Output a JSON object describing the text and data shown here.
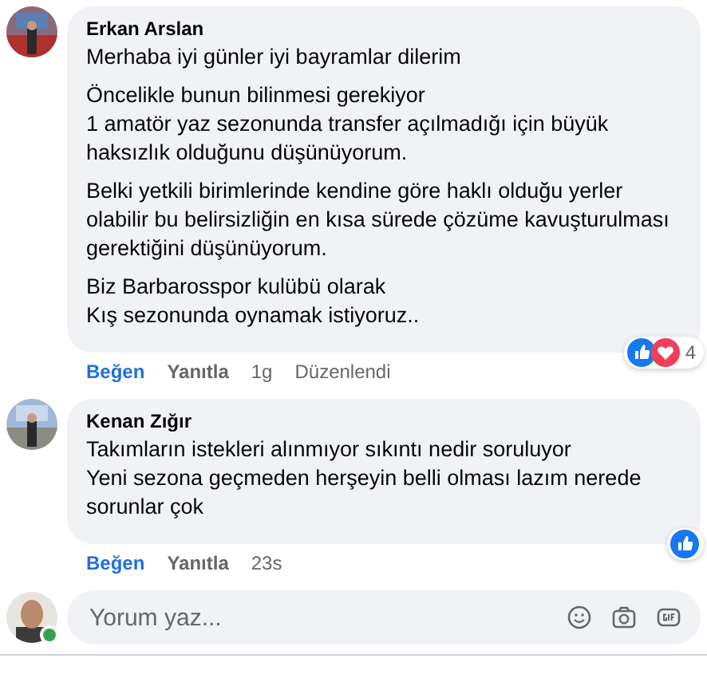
{
  "comments": [
    {
      "author": "Erkan Arslan",
      "paragraphs": [
        [
          "Merhaba iyi günler iyi bayramlar dilerim"
        ],
        [
          "Öncelikle bunun bilinmesi gerekiyor",
          "1 amatör yaz sezonunda transfer açılmadığı için büyük haksızlık olduğunu düşünüyorum."
        ],
        [
          "Belki yetkili birimlerinde kendine göre haklı olduğu yerler olabilir bu belirsizliğin en kısa sürede çözüme kavuşturulması gerektiğini düşünüyorum."
        ],
        [
          "Biz Barbarosspor kulübü olarak",
          "Kış sezonunda oynamak istiyoruz.."
        ]
      ],
      "actions": {
        "like": "Beğen",
        "liked": true,
        "reply": "Yanıtla",
        "time": "1g",
        "edited": "Düzenlendi"
      },
      "reactions": {
        "like": true,
        "love": true,
        "count": "4"
      }
    },
    {
      "author": "Kenan Zığır",
      "paragraphs": [
        [
          "Takımların istekleri alınmıyor sıkıntı nedir soruluyor",
          "Yeni sezona geçmeden herşeyin belli olması lazım nerede sorunlar çok"
        ]
      ],
      "actions": {
        "like": "Beğen",
        "liked": true,
        "reply": "Yanıtla",
        "time": "23s"
      },
      "reactions": {
        "like": true,
        "love": false
      }
    }
  ],
  "composer": {
    "placeholder": "Yorum yaz...",
    "online": true
  }
}
